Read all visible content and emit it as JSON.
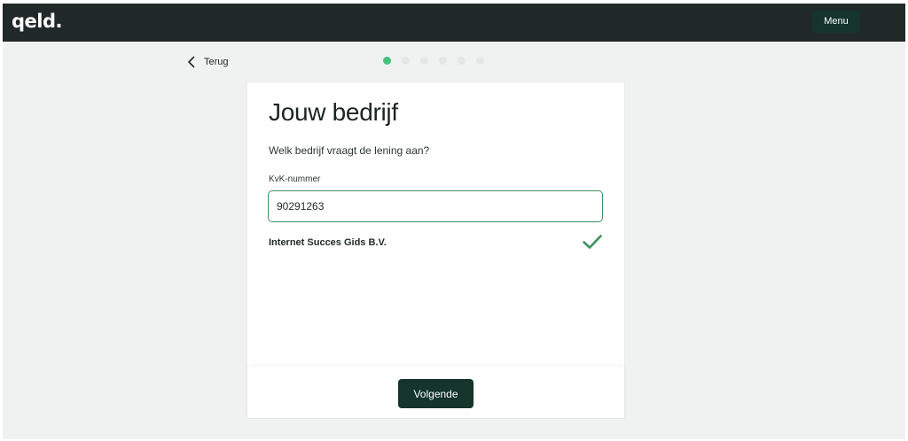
{
  "brand": {
    "logo": "qeld."
  },
  "header": {
    "menu_label": "Menu"
  },
  "nav": {
    "back_label": "Terug"
  },
  "progress": {
    "total_steps": 6,
    "current_step": 1
  },
  "form": {
    "title": "Jouw bedrijf",
    "question": "Welk bedrijf vraagt de lening aan?",
    "kvk_label": "KvK-nummer",
    "kvk_value": "90291263",
    "company_name": "Internet Succes Gids B.V.",
    "company_status_icon": "checkmark-icon"
  },
  "footer": {
    "next_label": "Volgende"
  },
  "colors": {
    "header_bg": "#212928",
    "button_bg": "#14342c",
    "accent_green": "#44c27a",
    "input_border": "#3f8f5d",
    "check_green": "#3f8f5d",
    "page_bg": "#f0f2f1"
  }
}
